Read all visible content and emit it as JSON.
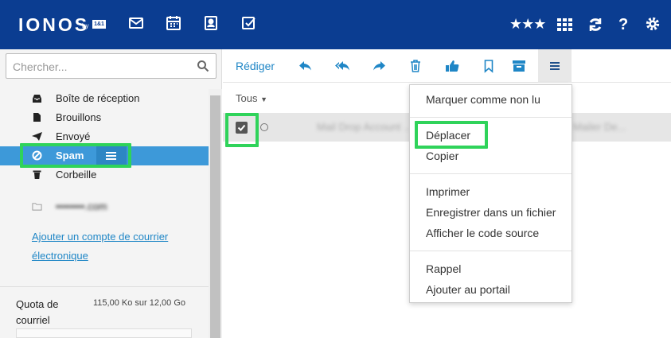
{
  "brand": {
    "name": "IONOS",
    "by": "by",
    "badge": "1&1"
  },
  "header": {
    "nav_icons": [
      "mail-icon",
      "calendar-icon",
      "contacts-icon",
      "tasks-icon"
    ],
    "right_icons": [
      "rating-stars-icon",
      "apps-grid-icon",
      "refresh-icon",
      "help-icon",
      "settings-gear-icon"
    ],
    "stars": "★★★",
    "help": "?"
  },
  "search": {
    "placeholder": "Chercher..."
  },
  "folders": [
    {
      "label": "Boîte de réception",
      "icon": "inbox-icon"
    },
    {
      "label": "Brouillons",
      "icon": "drafts-icon"
    },
    {
      "label": "Envoyé",
      "icon": "sent-icon"
    },
    {
      "label": "Spam",
      "icon": "spam-icon",
      "active": true
    },
    {
      "label": "Corbeille",
      "icon": "trash-icon"
    }
  ],
  "account": {
    "label": "••••••••.com"
  },
  "add_account_link": {
    "line1": "Ajouter un compte de courrier",
    "line2": "électronique"
  },
  "quota": {
    "label": "Quota de courriel",
    "value": "115,00 Ko sur 12,00 Go"
  },
  "toolbar": {
    "compose": "Rédiger",
    "icons": [
      "reply-icon",
      "reply-all-icon",
      "forward-icon",
      "delete-icon",
      "thumbs-up-icon",
      "bookmark-icon",
      "archive-icon",
      "more-menu-icon"
    ]
  },
  "list": {
    "filter": "Tous",
    "rows": [
      {
        "subject": "Mail Drop Account ...",
        "sender": "Mailer De..."
      }
    ]
  },
  "dropdown": {
    "items": [
      "Marquer comme non lu",
      "Déplacer",
      "Copier",
      "Imprimer",
      "Enregistrer dans un fichier",
      "Afficher le code source",
      "Rappel",
      "Ajouter au portail"
    ]
  },
  "colors": {
    "header": "#0b3d91",
    "accent": "#1f86c6",
    "active_folder": "#3d99d9",
    "highlight": "#2fd35a"
  }
}
